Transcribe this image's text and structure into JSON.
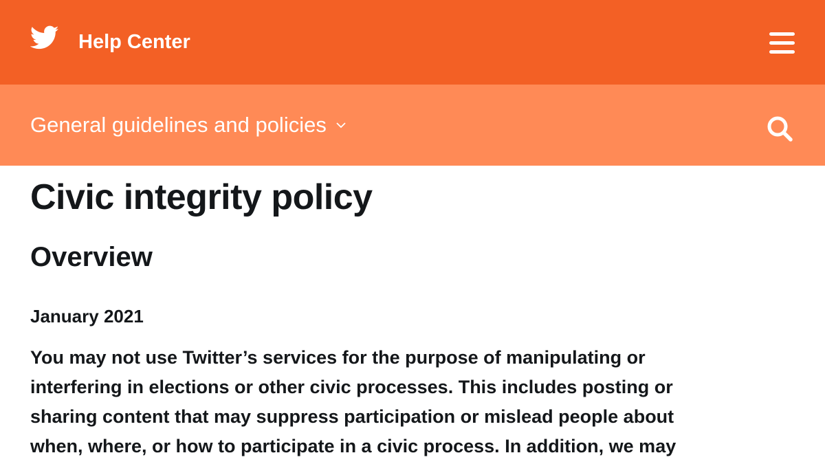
{
  "header": {
    "logo_icon": "twitter-bird-icon",
    "title": "Help Center",
    "menu_icon": "hamburger-menu-icon",
    "background_color": "#f36025"
  },
  "subheader": {
    "section_label": "General guidelines and policies",
    "dropdown_icon": "chevron-down-icon",
    "search_icon": "search-icon",
    "background_color": "#ff8a56"
  },
  "article": {
    "title": "Civic integrity policy",
    "section_heading": "Overview",
    "date": "January 2021",
    "body_lines": [
      "You may not use Twitter’s services for the purpose of manipulating or",
      "interfering in elections or other civic processes. This includes posting or",
      "sharing content that may suppress participation or mislead people about",
      "when, where, or how to participate in a civic process. In addition, we may"
    ]
  }
}
